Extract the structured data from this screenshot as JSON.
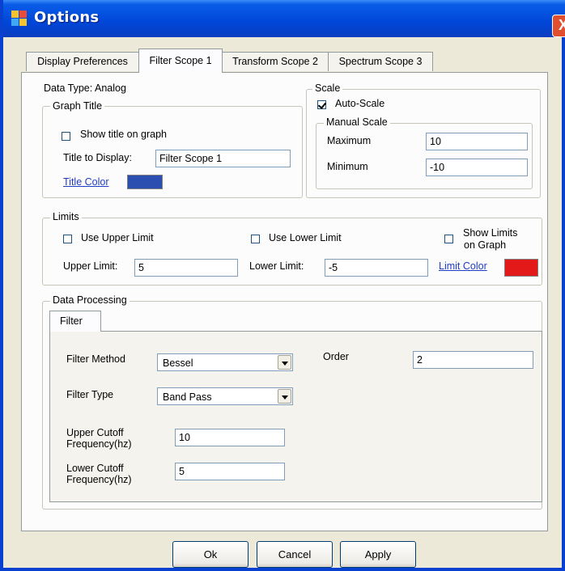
{
  "window": {
    "title": "Options",
    "close_glyph": "X",
    "app_icon": "options-app-icon",
    "close_icon": "close-icon"
  },
  "tabs": [
    {
      "label": "Display Preferences",
      "active": false
    },
    {
      "label": "Filter Scope 1",
      "active": true
    },
    {
      "label": "Transform Scope 2",
      "active": false
    },
    {
      "label": "Spectrum Scope 3",
      "active": false
    }
  ],
  "data_type": "Data Type: Analog",
  "graph_title": {
    "legend": "Graph Title",
    "show_title_label": "Show title on graph",
    "show_title_checked": false,
    "title_to_display_label": "Title to Display:",
    "title_value": "Filter Scope 1",
    "title_color_label": "Title Color",
    "title_color": "#2A4FB0"
  },
  "scale": {
    "legend": "Scale",
    "auto_scale_label": "Auto-Scale",
    "auto_scale_checked": true,
    "manual_legend": "Manual Scale",
    "maximum_label": "Maximum",
    "maximum_value": "10",
    "minimum_label": "Minimum",
    "minimum_value": "-10"
  },
  "limits": {
    "legend": "Limits",
    "use_upper_label": "Use Upper Limit",
    "use_upper_checked": false,
    "use_lower_label": "Use Lower Limit",
    "use_lower_checked": false,
    "show_limits_label_1": "Show Limits",
    "show_limits_label_2": "on Graph",
    "show_limits_checked": false,
    "upper_label": "Upper Limit:",
    "upper_value": "5",
    "lower_label": "Lower Limit:",
    "lower_value": "-5",
    "limit_color_label": "Limit Color",
    "limit_color": "#E31818"
  },
  "data_processing": {
    "legend": "Data Processing",
    "tab_label": "Filter",
    "filter_method_label": "Filter Method",
    "filter_method_value": "Bessel",
    "order_label": "Order",
    "order_value": "2",
    "filter_type_label": "Filter Type",
    "filter_type_value": "Band Pass",
    "upper_cutoff_label_1": "Upper Cutoff",
    "upper_cutoff_label_2": "Frequency(hz)",
    "upper_cutoff_value": "10",
    "lower_cutoff_label_1": "Lower Cutoff",
    "lower_cutoff_label_2": "Frequency(hz)",
    "lower_cutoff_value": "5"
  },
  "buttons": {
    "ok": "Ok",
    "cancel": "Cancel",
    "apply": "Apply"
  },
  "colors": {
    "titlebar": "#0046D8",
    "window_bg": "#ECE9D8",
    "link": "#1F3DC4"
  }
}
